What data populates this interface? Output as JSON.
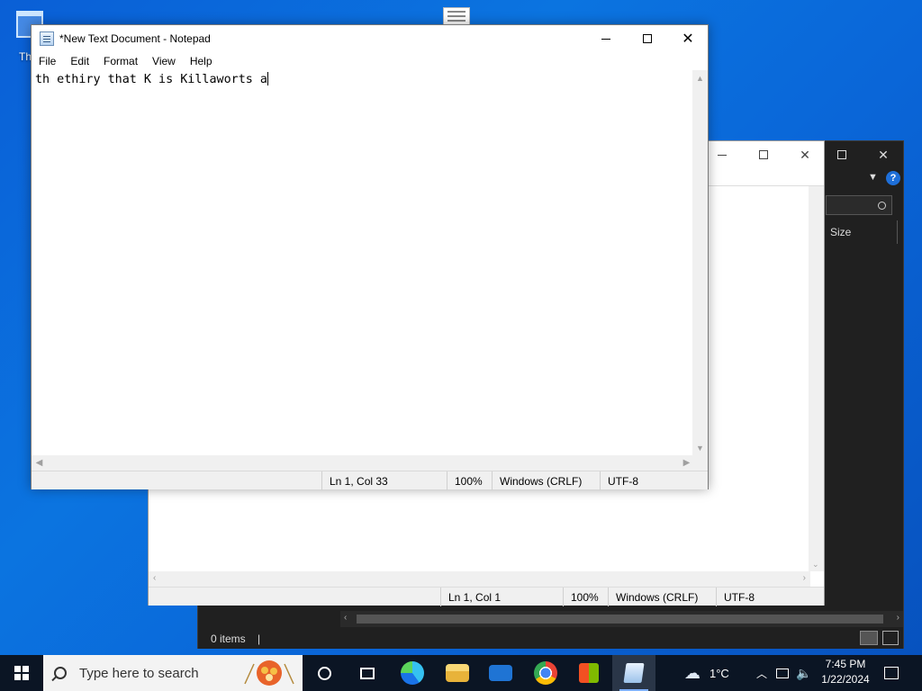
{
  "desktop": {
    "recycle_label": "Th"
  },
  "explorer": {
    "search_icon": "magnifier-icon",
    "column_size": "Size",
    "status_items": "0 items",
    "help_glyph": "?"
  },
  "notepad_back": {
    "status": {
      "position": "Ln 1, Col 1",
      "zoom": "100%",
      "line_ending": "Windows (CRLF)",
      "encoding": "UTF-8"
    }
  },
  "notepad": {
    "title": "*New Text Document - Notepad",
    "menu": [
      "File",
      "Edit",
      "Format",
      "View",
      "Help"
    ],
    "content": "th ethiry that K is Killaworts a",
    "status": {
      "position": "Ln 1, Col 33",
      "zoom": "100%",
      "line_ending": "Windows (CRLF)",
      "encoding": "UTF-8"
    }
  },
  "taskbar": {
    "search_placeholder": "Type here to search",
    "weather": "1°C",
    "time": "7:45 PM",
    "date": "1/22/2024",
    "apps": [
      "task-view-icon",
      "widgets-icon",
      "edge-icon",
      "file-explorer-icon",
      "mail-icon",
      "chrome-icon",
      "store-icon",
      "notepad-icon"
    ]
  }
}
